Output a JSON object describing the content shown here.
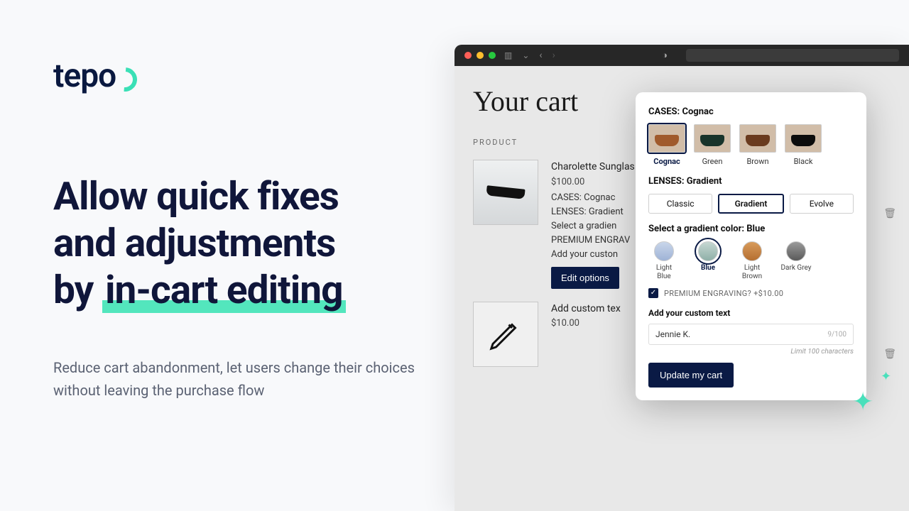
{
  "logo": {
    "text": "tepo"
  },
  "headline": {
    "line1": "Allow quick fixes",
    "line2": "and adjustments",
    "line3_prefix": "by ",
    "line3_highlight": "in-cart editing"
  },
  "subhead": "Reduce cart abandonment, let users change their choices without leaving the purchase flow",
  "cart": {
    "title": "Your cart",
    "product_header": "PRODUCT",
    "items": [
      {
        "name": "Charolette Sunglas",
        "price": "$100.00",
        "opts": [
          "CASES: Cognac",
          "LENSES: Gradient",
          "Select a gradien",
          "PREMIUM ENGRAV",
          "Add your custon"
        ],
        "edit_label": "Edit options"
      },
      {
        "name": "Add custom tex",
        "price": "$10.00"
      }
    ]
  },
  "popover": {
    "cases_label": "CASES: Cognac",
    "cases": [
      {
        "name": "Cognac",
        "hex": "#a05a2c",
        "selected": true
      },
      {
        "name": "Green",
        "hex": "#18342b"
      },
      {
        "name": "Brown",
        "hex": "#6a3b1f"
      },
      {
        "name": "Black",
        "hex": "#0c0c0c"
      }
    ],
    "lenses_label": "LENSES: Gradient",
    "lenses": [
      {
        "name": "Classic"
      },
      {
        "name": "Gradient",
        "selected": true
      },
      {
        "name": "Evolve"
      }
    ],
    "gradient_label": "Select a gradient color: Blue",
    "gradients": [
      {
        "name": "Light Blue",
        "hex": "#aec0dd"
      },
      {
        "name": "Blue",
        "hex": "#a7c5c0",
        "selected": true
      },
      {
        "name": "Light Brown",
        "hex": "#c68a4c"
      },
      {
        "name": "Dark Grey",
        "hex": "#7d7d7d"
      }
    ],
    "engraving_label": "PREMIUM ENGRAVING? +$10.00",
    "custom_text_label": "Add your custom text",
    "custom_text_value": "Jennie K.",
    "char_count": "9/100",
    "char_limit_hint": "Limit 100 characters",
    "update_label": "Update my cart"
  }
}
